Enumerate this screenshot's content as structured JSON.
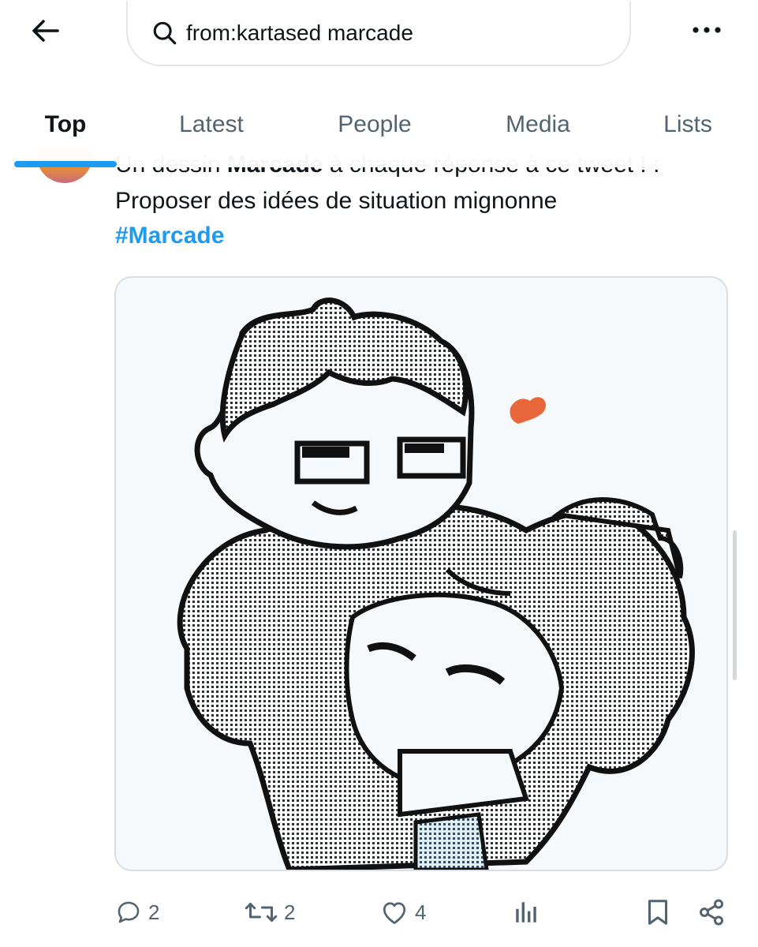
{
  "header": {
    "back_icon": "arrow-left-icon",
    "search": {
      "value": "from:kartased marcade",
      "icon": "search-icon"
    },
    "more_icon": "more-horizontal-icon"
  },
  "tabs": [
    {
      "label": "Top",
      "active": true
    },
    {
      "label": "Latest",
      "active": false
    },
    {
      "label": "People",
      "active": false
    },
    {
      "label": "Media",
      "active": false
    },
    {
      "label": "Lists",
      "active": false
    }
  ],
  "tweet": {
    "text_line1_pre": "Un dessin ",
    "text_line1_bold": "Marcade",
    "text_line1_post": " à chaque réponse à ce tweet ! :",
    "text_line2": "Proposer des idées de situation mignonne",
    "hashtag": "#Marcade",
    "media_alt": "pixel drawing of two characters hugging with a small heart",
    "actions": {
      "replies": {
        "icon": "reply-icon",
        "count": "2"
      },
      "retweets": {
        "icon": "retweet-icon",
        "count": "2"
      },
      "likes": {
        "icon": "heart-icon",
        "count": "4"
      },
      "views": {
        "icon": "analytics-icon"
      },
      "bookmark": {
        "icon": "bookmark-icon"
      },
      "share": {
        "icon": "share-icon"
      }
    }
  },
  "colors": {
    "accent": "#1d9bf0",
    "text": "#0f1419",
    "muted": "#536471",
    "heart": "#e8673a"
  }
}
